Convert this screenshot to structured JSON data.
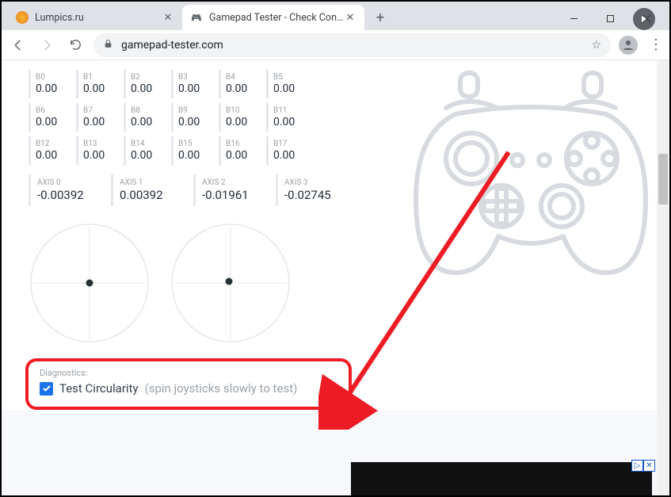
{
  "window": {
    "tabs": [
      {
        "title": "Lumpics.ru",
        "active": false
      },
      {
        "title": "Gamepad Tester - Check Control",
        "active": true
      }
    ],
    "url": "gamepad-tester.com"
  },
  "buttons": [
    [
      {
        "label": "B0",
        "value": "0.00"
      },
      {
        "label": "B1",
        "value": "0.00"
      },
      {
        "label": "B2",
        "value": "0.00"
      },
      {
        "label": "B3",
        "value": "0.00"
      },
      {
        "label": "B4",
        "value": "0.00"
      },
      {
        "label": "B5",
        "value": "0.00"
      }
    ],
    [
      {
        "label": "B6",
        "value": "0.00"
      },
      {
        "label": "B7",
        "value": "0.00"
      },
      {
        "label": "B8",
        "value": "0.00"
      },
      {
        "label": "B9",
        "value": "0.00"
      },
      {
        "label": "B10",
        "value": "0.00"
      },
      {
        "label": "B11",
        "value": "0.00"
      }
    ],
    [
      {
        "label": "B12",
        "value": "0.00"
      },
      {
        "label": "B13",
        "value": "0.00"
      },
      {
        "label": "B14",
        "value": "0.00"
      },
      {
        "label": "B15",
        "value": "0.00"
      },
      {
        "label": "B16",
        "value": "0.00"
      },
      {
        "label": "B17",
        "value": "0.00"
      }
    ]
  ],
  "axes": [
    {
      "label": "AXIS 0",
      "value": "-0.00392"
    },
    {
      "label": "AXIS 1",
      "value": "0.00392"
    },
    {
      "label": "AXIS 2",
      "value": "-0.01961"
    },
    {
      "label": "AXIS 3",
      "value": "-0.02745"
    }
  ],
  "diagnostics": {
    "header": "Diagnostics:",
    "checkbox_label": "Test Circularity",
    "hint": "(spin joysticks slowly to test)",
    "checked": true
  }
}
